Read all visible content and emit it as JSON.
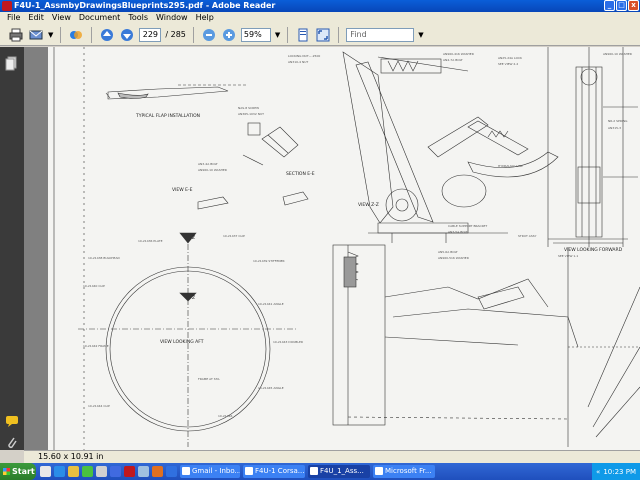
{
  "window": {
    "title": "F4U-1_AssmbyDrawingsBlueprints295.pdf - Adobe Reader",
    "minimize": "_",
    "maximize": "□",
    "close": "x"
  },
  "menu": [
    "File",
    "Edit",
    "View",
    "Document",
    "Tools",
    "Window",
    "Help"
  ],
  "toolbar": {
    "page_current": "229",
    "page_total": "/ 285",
    "zoom": "59%",
    "find_placeholder": "Find"
  },
  "status": {
    "page_size": "15.60 x 10.91 in"
  },
  "drawing_labels": {
    "typical_flap": "TYPICAL FLAP INSTALLATION",
    "view_ee": "VIEW E-E",
    "section_ee": "SECTION E-E",
    "view_zz": "VIEW Z-Z",
    "view_looking_forward": "VIEW LOOKING FORWARD",
    "view_looking_aft": "VIEW LOOKING AFT",
    "axis_z": "Z"
  },
  "taskbar": {
    "start": "Start",
    "tasks": [
      {
        "label": "Gmail - Inbo...",
        "active": false
      },
      {
        "label": "F4U-1 Corsa...",
        "active": false
      },
      {
        "label": "F4U_1_Ass...",
        "active": true
      },
      {
        "label": "Microsoft Fr...",
        "active": false
      }
    ],
    "tray_arrow": "«",
    "time": "10:23 PM"
  },
  "colors": {
    "titlebar": "#0a5ed8",
    "taskbar": "#245edb",
    "start": "#3c9a3c",
    "viewer_bg": "#808080",
    "left_panel": "#3a3a3a"
  }
}
